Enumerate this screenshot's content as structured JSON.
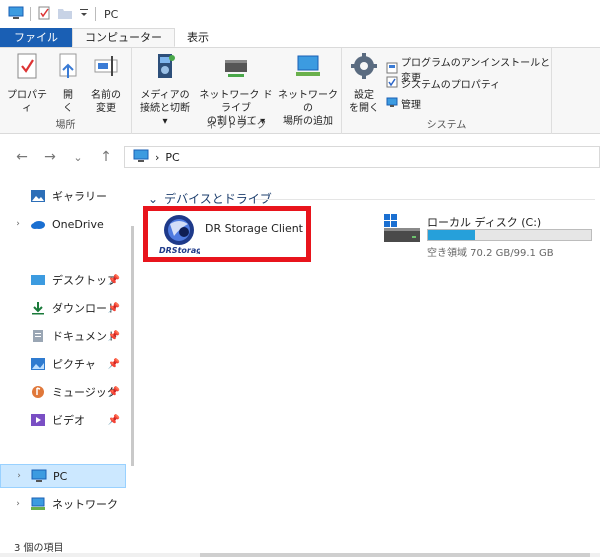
{
  "titlebar": {
    "title": "PC"
  },
  "tabs": {
    "file": "ファイル",
    "computer": "コンピューター",
    "view": "表示"
  },
  "ribbon": {
    "location": {
      "label": "場所",
      "properties": "プロパティ",
      "open_l1": "開",
      "open_l2": "く",
      "rename_l1": "名前の",
      "rename_l2": "変更"
    },
    "network": {
      "label": "ネットワーク",
      "media_l1": "メディアの",
      "media_l2": "接続と切断",
      "map_l1": "ネットワーク ドライブ",
      "map_l2": "の割り当て",
      "add_l1": "ネットワークの",
      "add_l2": "場所の追加"
    },
    "system": {
      "label": "システム",
      "settings_l1": "設定",
      "settings_l2": "を開く",
      "uninstall": "プログラムのアンインストールと変更",
      "sysprops": "システムのプロパティ",
      "manage": "管理"
    }
  },
  "nav": {
    "back": "←",
    "forward": "→",
    "recent": "⌄",
    "up": "↑"
  },
  "address": {
    "separator": "›",
    "location": "PC"
  },
  "sidebar": {
    "items": [
      {
        "label": "ギャラリー"
      },
      {
        "label": "OneDrive"
      },
      {
        "label": "デスクトップ"
      },
      {
        "label": "ダウンロード"
      },
      {
        "label": "ドキュメント"
      },
      {
        "label": "ピクチャ"
      },
      {
        "label": "ミュージック"
      },
      {
        "label": "ビデオ"
      },
      {
        "label": "PC"
      },
      {
        "label": "ネットワーク"
      }
    ]
  },
  "content": {
    "section_title": "デバイスとドライブ",
    "dr_drive": {
      "name": "DR Storage Client",
      "logo_text": "DRStorage"
    },
    "c_drive": {
      "name": "ローカル ディスク (C:)",
      "used_fraction": 0.29,
      "free_text": "空き領域 70.2 GB/99.1 GB"
    }
  },
  "status": {
    "count": "3 個の項目"
  },
  "colors": {
    "accent": "#1a5fb4",
    "highlight": "#e8141c",
    "bar": "#26a0da",
    "selected": "#cce8ff"
  }
}
